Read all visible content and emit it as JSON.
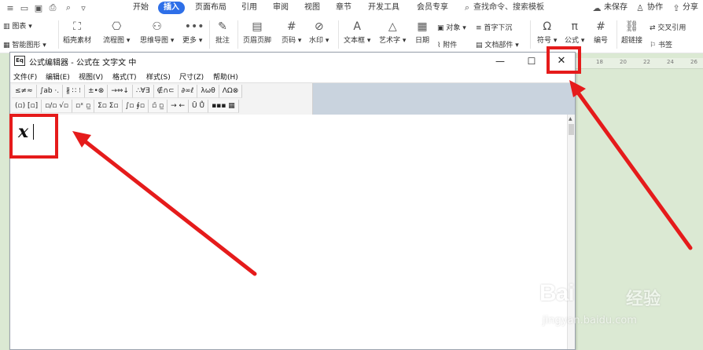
{
  "topbar": {
    "tabs": [
      {
        "label": "开始"
      },
      {
        "label": "插入",
        "active": true
      },
      {
        "label": "页面布局"
      },
      {
        "label": "引用"
      },
      {
        "label": "审阅"
      },
      {
        "label": "视图"
      },
      {
        "label": "章节"
      },
      {
        "label": "开发工具"
      },
      {
        "label": "会员专享"
      }
    ],
    "search": "查找命令、搜索模板",
    "unsaved": "未保存",
    "collab": "协作",
    "share": "分享"
  },
  "ribbon": {
    "chart": "图表",
    "smartart": "智能图形",
    "material": "稻壳素材",
    "flowchart": "流程图",
    "mindmap": "思维导图",
    "more": "更多",
    "comment": "批注",
    "headerfooter": "页眉页脚",
    "pagenum": "页码",
    "watermark": "水印",
    "textbox": "文本框",
    "wordart": "艺术字",
    "date": "日期",
    "object": "对象",
    "attachment": "附件",
    "dropcap": "首字下沉",
    "docpart": "文档部件",
    "symbol": "符号",
    "formula": "公式",
    "numbering": "编号",
    "hyperlink": "超链接",
    "crossref": "交叉引用",
    "bookmark": "书签",
    "accent_color": "#2e6fe8"
  },
  "doc": {
    "ruler_labels": [
      "18",
      "20",
      "22",
      "24",
      "26"
    ]
  },
  "editor": {
    "app_icon_text": "Eq",
    "title": "公式编辑器 - 公式在 文字文 中",
    "controls": {
      "minimize": "—",
      "maximize": "☐",
      "close": "✕"
    },
    "menus": [
      "文件(F)",
      "编辑(E)",
      "视图(V)",
      "格式(T)",
      "样式(S)",
      "尺寸(Z)",
      "帮助(H)"
    ],
    "palette_row1": [
      "≤≠≈",
      "∫ab ·.",
      "∦ ∷ ⁝",
      "±•⊗",
      "→⇔↓",
      "∴∀∃",
      "∉∩⊂",
      "∂∞ℓ",
      "λωθ",
      "ΛΩ⊗"
    ],
    "palette_row2": [
      "(▫) [▫]",
      "▫/▫ √▫",
      "▫ˣ ▫̲",
      "Σ▫ Σ▫",
      "∫▫ ∮▫",
      "▫̄ ▫̲",
      "→ ←",
      "Ū Ů",
      "▪▪▪ ▦"
    ],
    "formula_text": "x"
  },
  "annotations": {
    "color": "#e51b1b"
  },
  "watermark": {
    "brand": "Bai",
    "brand_cn": "经验",
    "url": "jingyan.baidu.com"
  }
}
